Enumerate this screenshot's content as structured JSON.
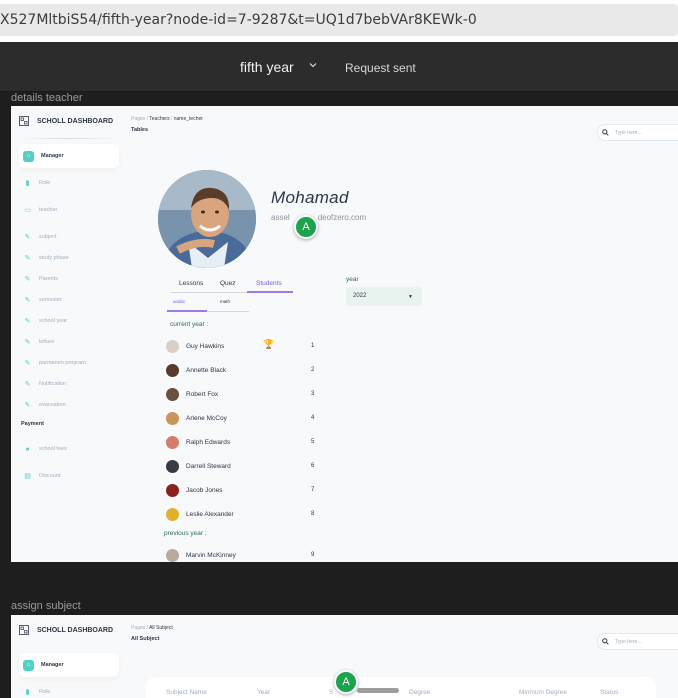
{
  "browser": {
    "url": "X527MltbiS54/fifth-year?node-id=7-9287&t=UQ1d7bebVAr8KEWk-0"
  },
  "figma": {
    "project": "fifth year",
    "request_status": "Request sent"
  },
  "frames": [
    {
      "label": "details teacher",
      "brand": "SCHOLL DASHBOARD",
      "breadcrumb": {
        "root": "Pages",
        "parent": "Teachers",
        "current": "name_techer"
      },
      "page_title": "Tables",
      "search_placeholder": "Type here...",
      "sidebar": [
        {
          "label": "Manager",
          "icon": "home-icon",
          "active": true
        },
        {
          "label": "Role",
          "icon": "chart-icon"
        },
        {
          "label": "teacher",
          "icon": "card-icon"
        },
        {
          "label": "subject",
          "icon": "wrench-icon"
        },
        {
          "label": "study phase",
          "icon": "wrench-icon"
        },
        {
          "label": "Parents",
          "icon": "wrench-icon"
        },
        {
          "label": "semester",
          "icon": "wrench-icon"
        },
        {
          "label": "school year",
          "icon": "wrench-icon"
        },
        {
          "label": "letture",
          "icon": "wrench-icon"
        },
        {
          "label": "parmanen program",
          "icon": "wrench-icon"
        },
        {
          "label": "Notification",
          "icon": "wrench-icon"
        },
        {
          "label": "evacuation",
          "icon": "wrench-icon"
        }
      ],
      "sidebar_section": "Payment",
      "sidebar_payment": [
        {
          "label": "school fees",
          "icon": "user-icon"
        },
        {
          "label": "Discount",
          "icon": "document-icon"
        }
      ],
      "teacher": {
        "name": "Mohamad",
        "email_start": "assel",
        "email_end": "deofzero.com"
      },
      "tabs": [
        "Lessons",
        "Quez",
        "Students"
      ],
      "selected_tab": "Students",
      "subtabs": [
        "arabic",
        "math"
      ],
      "year_label": "year",
      "year_value": "2022",
      "current_year_label": "current year :",
      "previous_year_label": "previous year :",
      "students_current": [
        {
          "name": "Guy Hawkins",
          "rank": "1",
          "badge": "trophy-icon",
          "color": "#d9cfc7"
        },
        {
          "name": "Annette Black",
          "rank": "2",
          "color": "#5a3a2a"
        },
        {
          "name": "Robert Fox",
          "rank": "3",
          "color": "#6a5040"
        },
        {
          "name": "Arlene McCoy",
          "rank": "4",
          "color": "#c9955a"
        },
        {
          "name": "Ralph Edwards",
          "rank": "5",
          "color": "#d57b6a"
        },
        {
          "name": "Darrell Steward",
          "rank": "6",
          "color": "#3b3b44"
        },
        {
          "name": "Jacob Jones",
          "rank": "7",
          "color": "#8a2020"
        },
        {
          "name": "Leslie Alexander",
          "rank": "8",
          "color": "#e0b22a"
        }
      ],
      "students_previous": [
        {
          "name": "Marvin McKinney",
          "rank": "9",
          "color": "#b8aa9e"
        }
      ]
    },
    {
      "label": "assign subject",
      "brand": "SCHOLL DASHBOARD",
      "breadcrumb": {
        "root": "Pages",
        "current": "All Subject"
      },
      "page_title": "All Subject",
      "search_placeholder": "Type here...",
      "sidebar": [
        {
          "label": "Manager",
          "icon": "home-icon",
          "active": true
        },
        {
          "label": "Role",
          "icon": "chart-icon"
        }
      ],
      "columns": [
        "Subject Name",
        "Year",
        "S",
        "Degree",
        "Minmum Degree",
        "Status"
      ]
    }
  ],
  "collaborator_initial": "A",
  "colors": {
    "accent_teal": "#4fd1c5",
    "accent_purple": "#9f7aea",
    "collaborator_green": "#1ba34e",
    "figma_dark": "#2c2c2c"
  }
}
